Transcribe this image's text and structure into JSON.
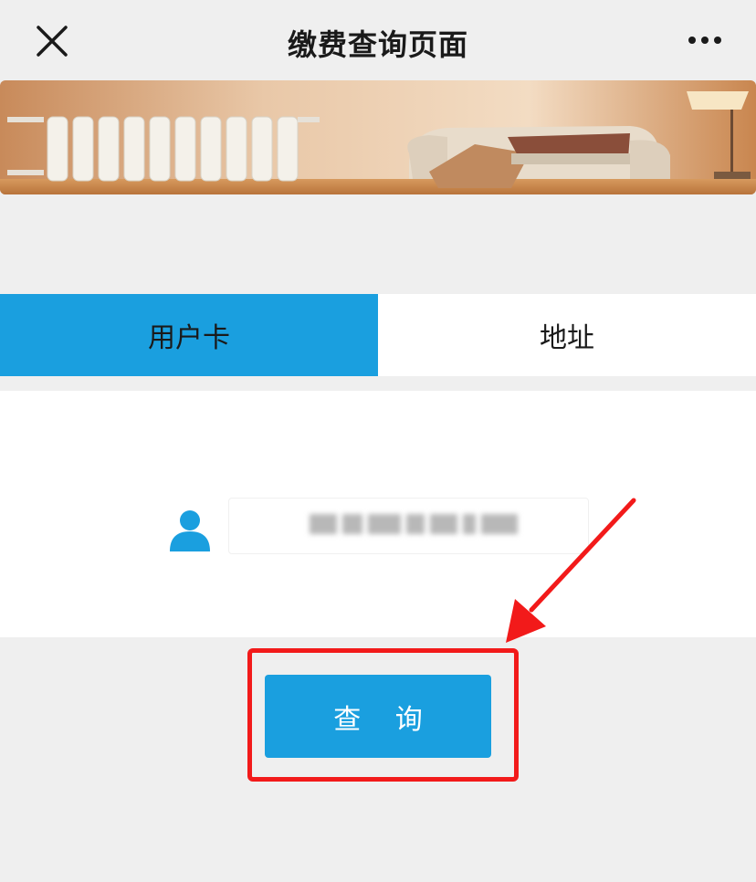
{
  "header": {
    "title": "缴费查询页面",
    "close_icon": "close-icon",
    "more_icon": "more-dots-icon"
  },
  "banner": {
    "description_icon": "banner-image"
  },
  "tabs": [
    {
      "label": "用户卡",
      "active": true
    },
    {
      "label": "地址",
      "active": false
    }
  ],
  "form": {
    "user_icon": "user-icon",
    "card_input_value": "[blurred]"
  },
  "actions": {
    "query_label": "查 询"
  },
  "colors": {
    "accent": "#1a9fdf",
    "highlight": "#f21a1a",
    "background": "#efefef"
  }
}
